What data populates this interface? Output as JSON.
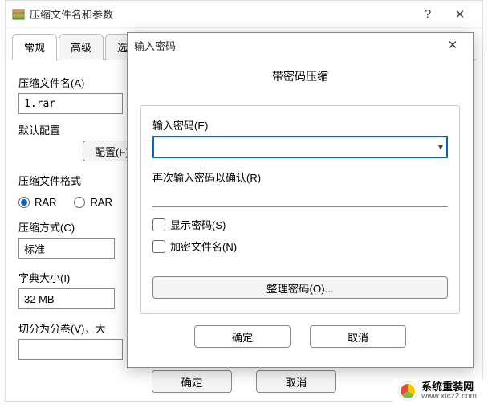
{
  "parent": {
    "title": "压缩文件名和参数",
    "tabs": [
      "常规",
      "高级",
      "选项"
    ],
    "filename_label": "压缩文件名(A)",
    "filename_value": "1.rar",
    "profile_label": "默认配置",
    "profile_button": "配置(F)",
    "format_label": "压缩文件格式",
    "format_rar": "RAR",
    "format_rar2": "RAR",
    "method_label": "压缩方式(C)",
    "method_value": "标准",
    "dict_label": "字典大小(I)",
    "dict_value": "32 MB",
    "split_label": "切分为分卷(V)，大",
    "ok": "确定",
    "cancel": "取消"
  },
  "modal": {
    "title": "输入密码",
    "heading": "带密码压缩",
    "pw_label": "输入密码(E)",
    "pw2_label": "再次输入密码以确认(R)",
    "show_pw": "显示密码(S)",
    "encrypt_names": "加密文件名(N)",
    "organize": "整理密码(O)...",
    "ok": "确定",
    "cancel": "取消"
  },
  "watermark": {
    "text": "系统重装网",
    "url": "www.xtcz2.com"
  }
}
